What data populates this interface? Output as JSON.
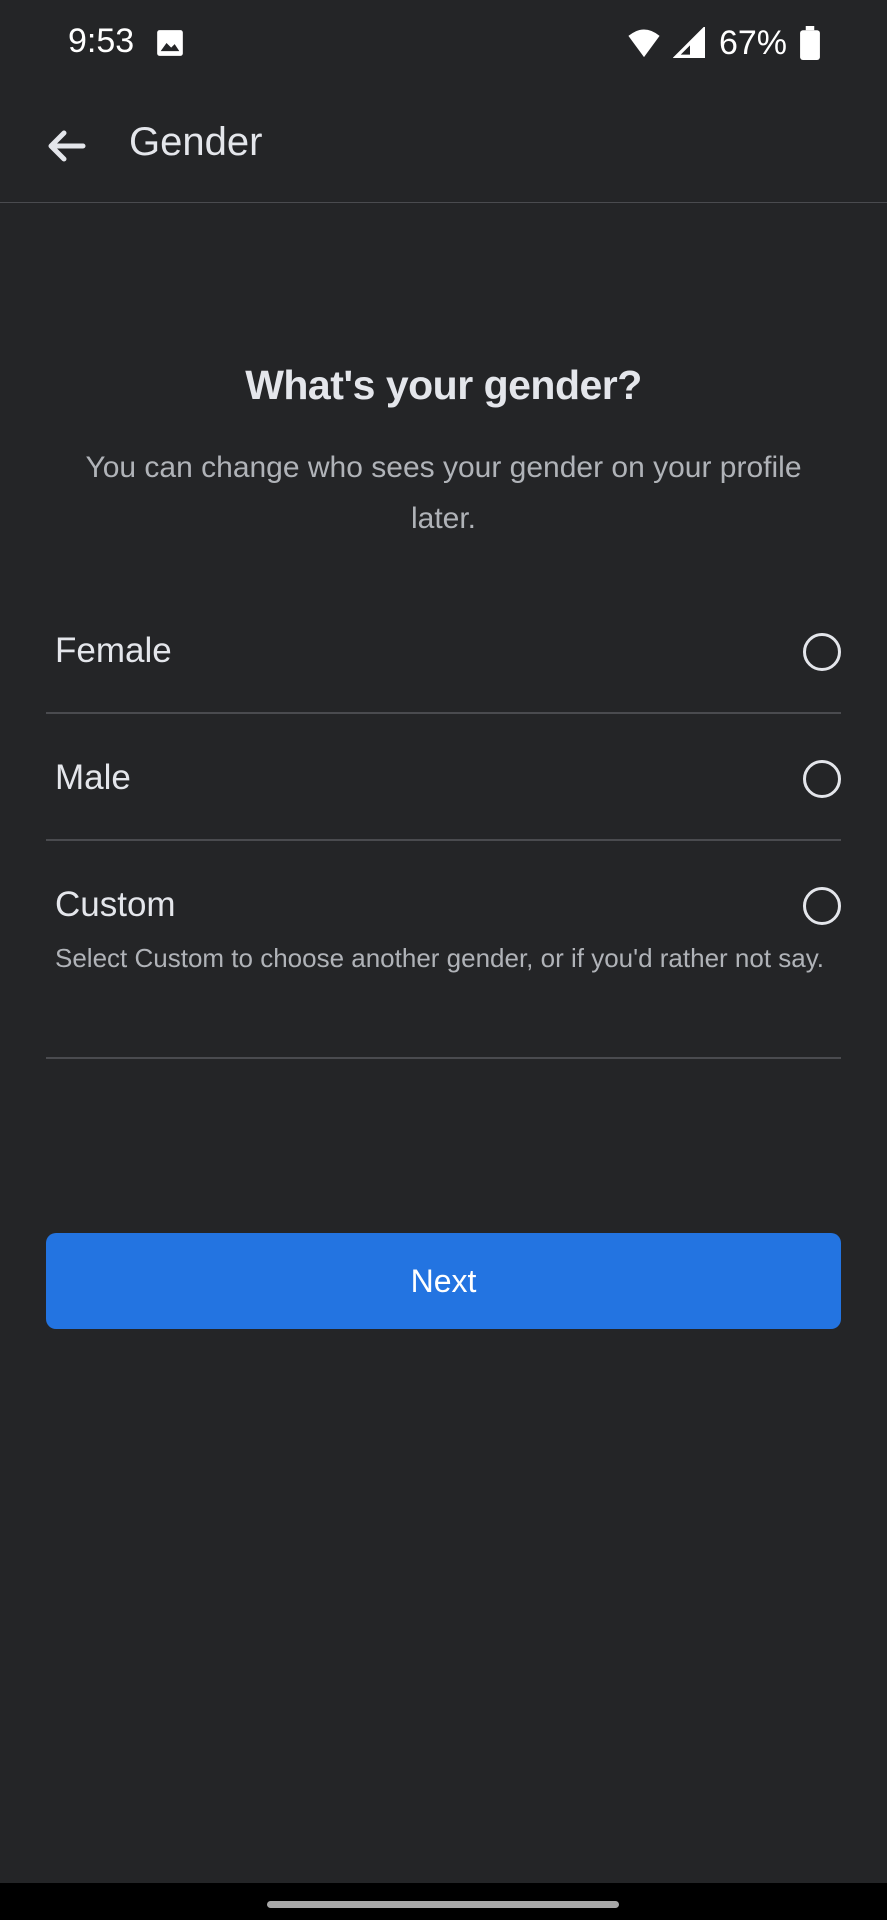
{
  "status_bar": {
    "time": "9:53",
    "battery_percent": "67%",
    "icons": [
      "image-icon",
      "wifi-icon",
      "signal-icon",
      "battery-icon"
    ]
  },
  "app_bar": {
    "title": "Gender",
    "back_icon": "arrow-left-icon"
  },
  "content": {
    "heading": "What's your gender?",
    "subheading": "You can change who sees your gender on your profile later.",
    "options": [
      {
        "label": "Female",
        "selected": false
      },
      {
        "label": "Male",
        "selected": false
      },
      {
        "label": "Custom",
        "selected": false,
        "hint": "Select Custom to choose another gender, or if you'd rather not say."
      }
    ],
    "next_label": "Next"
  },
  "colors": {
    "background": "#242527",
    "primary_button": "#2374e1",
    "text_primary": "#e4e6eb",
    "text_secondary": "#b0b3b8",
    "divider": "#4a4b4f"
  }
}
